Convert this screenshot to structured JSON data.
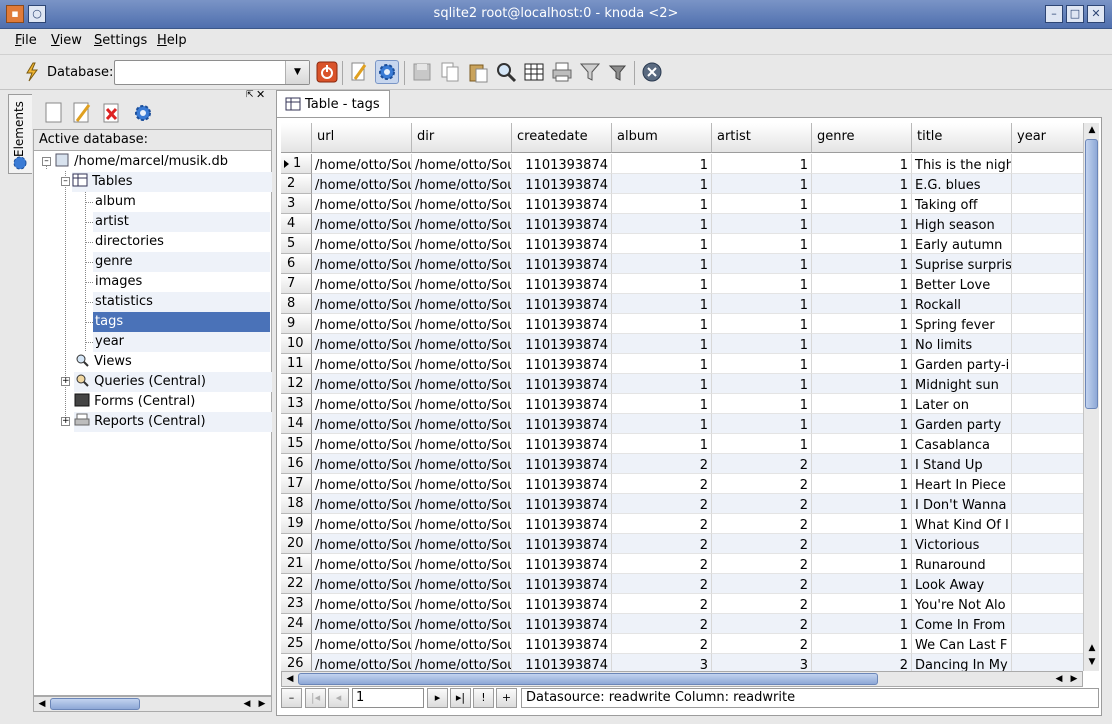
{
  "window": {
    "title": "sqlite2 root@localhost:0 - knoda <2>"
  },
  "menu": {
    "file": {
      "pre": "",
      "u": "F",
      "post": "ile"
    },
    "view": {
      "pre": "",
      "u": "V",
      "post": "iew"
    },
    "settings": {
      "pre": "",
      "u": "S",
      "post": "ettings"
    },
    "help": {
      "pre": "",
      "u": "H",
      "post": "elp"
    }
  },
  "toolbar": {
    "database_label": "Database:",
    "database_value": ""
  },
  "sidebar": {
    "tab_label": "Elements",
    "active_db_label": "Active database:",
    "tree": {
      "db": "/home/marcel/musik.db",
      "tables": "Tables",
      "table_items": [
        "album",
        "artist",
        "directories",
        "genre",
        "images",
        "statistics",
        "tags",
        "year"
      ],
      "selected_index": 6,
      "views": "Views",
      "queries": "Queries (Central)",
      "forms": "Forms (Central)",
      "reports": "Reports (Central)"
    }
  },
  "document": {
    "tab_label": "Table - tags",
    "columns": [
      "url",
      "dir",
      "createdate",
      "album",
      "artist",
      "genre",
      "title",
      "year"
    ],
    "rows": [
      {
        "n": "1",
        "url": "/home/otto/Sou",
        "dir": "/home/otto/Sou",
        "createdate": "1101393874",
        "album": "1",
        "artist": "1",
        "genre": "1",
        "title": "This is the nigh",
        "year": ""
      },
      {
        "n": "2",
        "url": "/home/otto/Sou",
        "dir": "/home/otto/Sou",
        "createdate": "1101393874",
        "album": "1",
        "artist": "1",
        "genre": "1",
        "title": "E.G. blues",
        "year": ""
      },
      {
        "n": "3",
        "url": "/home/otto/Sou",
        "dir": "/home/otto/Sou",
        "createdate": "1101393874",
        "album": "1",
        "artist": "1",
        "genre": "1",
        "title": "Taking off",
        "year": ""
      },
      {
        "n": "4",
        "url": "/home/otto/Sou",
        "dir": "/home/otto/Sou",
        "createdate": "1101393874",
        "album": "1",
        "artist": "1",
        "genre": "1",
        "title": "High season",
        "year": ""
      },
      {
        "n": "5",
        "url": "/home/otto/Sou",
        "dir": "/home/otto/Sou",
        "createdate": "1101393874",
        "album": "1",
        "artist": "1",
        "genre": "1",
        "title": "Early autumn",
        "year": ""
      },
      {
        "n": "6",
        "url": "/home/otto/Sou",
        "dir": "/home/otto/Sou",
        "createdate": "1101393874",
        "album": "1",
        "artist": "1",
        "genre": "1",
        "title": "Suprise surpris",
        "year": ""
      },
      {
        "n": "7",
        "url": "/home/otto/Sou",
        "dir": "/home/otto/Sou",
        "createdate": "1101393874",
        "album": "1",
        "artist": "1",
        "genre": "1",
        "title": "Better Love",
        "year": ""
      },
      {
        "n": "8",
        "url": "/home/otto/Sou",
        "dir": "/home/otto/Sou",
        "createdate": "1101393874",
        "album": "1",
        "artist": "1",
        "genre": "1",
        "title": "Rockall",
        "year": ""
      },
      {
        "n": "9",
        "url": "/home/otto/Sou",
        "dir": "/home/otto/Sou",
        "createdate": "1101393874",
        "album": "1",
        "artist": "1",
        "genre": "1",
        "title": "Spring fever",
        "year": ""
      },
      {
        "n": "10",
        "url": "/home/otto/Sou",
        "dir": "/home/otto/Sou",
        "createdate": "1101393874",
        "album": "1",
        "artist": "1",
        "genre": "1",
        "title": "No limits",
        "year": ""
      },
      {
        "n": "11",
        "url": "/home/otto/Sou",
        "dir": "/home/otto/Sou",
        "createdate": "1101393874",
        "album": "1",
        "artist": "1",
        "genre": "1",
        "title": "Garden party-i",
        "year": ""
      },
      {
        "n": "12",
        "url": "/home/otto/Sou",
        "dir": "/home/otto/Sou",
        "createdate": "1101393874",
        "album": "1",
        "artist": "1",
        "genre": "1",
        "title": "Midnight sun",
        "year": ""
      },
      {
        "n": "13",
        "url": "/home/otto/Sou",
        "dir": "/home/otto/Sou",
        "createdate": "1101393874",
        "album": "1",
        "artist": "1",
        "genre": "1",
        "title": "Later on",
        "year": ""
      },
      {
        "n": "14",
        "url": "/home/otto/Sou",
        "dir": "/home/otto/Sou",
        "createdate": "1101393874",
        "album": "1",
        "artist": "1",
        "genre": "1",
        "title": "Garden party",
        "year": ""
      },
      {
        "n": "15",
        "url": "/home/otto/Sou",
        "dir": "/home/otto/Sou",
        "createdate": "1101393874",
        "album": "1",
        "artist": "1",
        "genre": "1",
        "title": "Casablanca",
        "year": ""
      },
      {
        "n": "16",
        "url": "/home/otto/Sou",
        "dir": "/home/otto/Sou",
        "createdate": "1101393874",
        "album": "2",
        "artist": "2",
        "genre": "1",
        "title": "I Stand Up",
        "year": ""
      },
      {
        "n": "17",
        "url": "/home/otto/Sou",
        "dir": "/home/otto/Sou",
        "createdate": "1101393874",
        "album": "2",
        "artist": "2",
        "genre": "1",
        "title": "Heart In Piece",
        "year": ""
      },
      {
        "n": "18",
        "url": "/home/otto/Sou",
        "dir": "/home/otto/Sou",
        "createdate": "1101393874",
        "album": "2",
        "artist": "2",
        "genre": "1",
        "title": "I Don't Wanna",
        "year": ""
      },
      {
        "n": "19",
        "url": "/home/otto/Sou",
        "dir": "/home/otto/Sou",
        "createdate": "1101393874",
        "album": "2",
        "artist": "2",
        "genre": "1",
        "title": "What Kind Of I",
        "year": ""
      },
      {
        "n": "20",
        "url": "/home/otto/Sou",
        "dir": "/home/otto/Sou",
        "createdate": "1101393874",
        "album": "2",
        "artist": "2",
        "genre": "1",
        "title": "Victorious",
        "year": ""
      },
      {
        "n": "21",
        "url": "/home/otto/Sou",
        "dir": "/home/otto/Sou",
        "createdate": "1101393874",
        "album": "2",
        "artist": "2",
        "genre": "1",
        "title": "Runaround",
        "year": ""
      },
      {
        "n": "22",
        "url": "/home/otto/Sou",
        "dir": "/home/otto/Sou",
        "createdate": "1101393874",
        "album": "2",
        "artist": "2",
        "genre": "1",
        "title": "Look Away",
        "year": ""
      },
      {
        "n": "23",
        "url": "/home/otto/Sou",
        "dir": "/home/otto/Sou",
        "createdate": "1101393874",
        "album": "2",
        "artist": "2",
        "genre": "1",
        "title": "You're Not Alo",
        "year": ""
      },
      {
        "n": "24",
        "url": "/home/otto/Sou",
        "dir": "/home/otto/Sou",
        "createdate": "1101393874",
        "album": "2",
        "artist": "2",
        "genre": "1",
        "title": "Come In From",
        "year": ""
      },
      {
        "n": "25",
        "url": "/home/otto/Sou",
        "dir": "/home/otto/Sou",
        "createdate": "1101393874",
        "album": "2",
        "artist": "2",
        "genre": "1",
        "title": "We Can Last F",
        "year": ""
      },
      {
        "n": "26",
        "url": "/home/otto/Sou",
        "dir": "/home/otto/Sou",
        "createdate": "1101393874",
        "album": "3",
        "artist": "3",
        "genre": "2",
        "title": "Dancing In My",
        "year": ""
      }
    ]
  },
  "navigator": {
    "minus": "–",
    "first": "|◂",
    "prev": "◂",
    "record": "1",
    "next": "▸",
    "last": "▸|",
    "bang": "!",
    "plus": "+",
    "status": "Datasource: readwrite Column: readwrite"
  },
  "colors": {
    "titlebar": "#4f6fae",
    "selection": "#4a72b8",
    "alt_row": "#eef2f9"
  }
}
